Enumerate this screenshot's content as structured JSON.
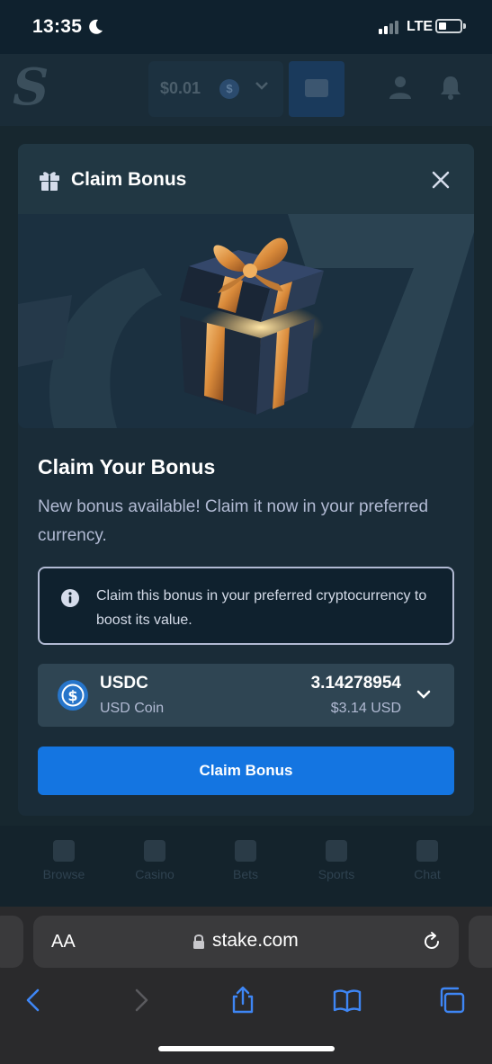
{
  "status_bar": {
    "time": "13:35",
    "network": "LTE"
  },
  "app_header": {
    "logo": "S",
    "balance": "$0.01",
    "coin_symbol": "$"
  },
  "bottom_nav": {
    "items": [
      {
        "label": "Browse"
      },
      {
        "label": "Casino"
      },
      {
        "label": "Bets"
      },
      {
        "label": "Sports"
      },
      {
        "label": "Chat"
      }
    ]
  },
  "modal": {
    "title": "Claim Bonus",
    "heading": "Claim Your Bonus",
    "description": "New bonus available! Claim it now in your preferred currency.",
    "info": "Claim this bonus in your preferred cryptocurrency to boost its value.",
    "currency": {
      "code": "USDC",
      "name": "USD Coin",
      "amount": "3.14278954",
      "fiat": "$3.14 USD"
    },
    "claim_button": "Claim Bonus"
  },
  "browser": {
    "text_size": "AA",
    "url": "stake.com"
  },
  "colors": {
    "primary_button": "#1475e1",
    "background": "#1a2c38",
    "panel": "#213743",
    "muted_text": "#b1bad3",
    "usdc": "#2775ca"
  }
}
